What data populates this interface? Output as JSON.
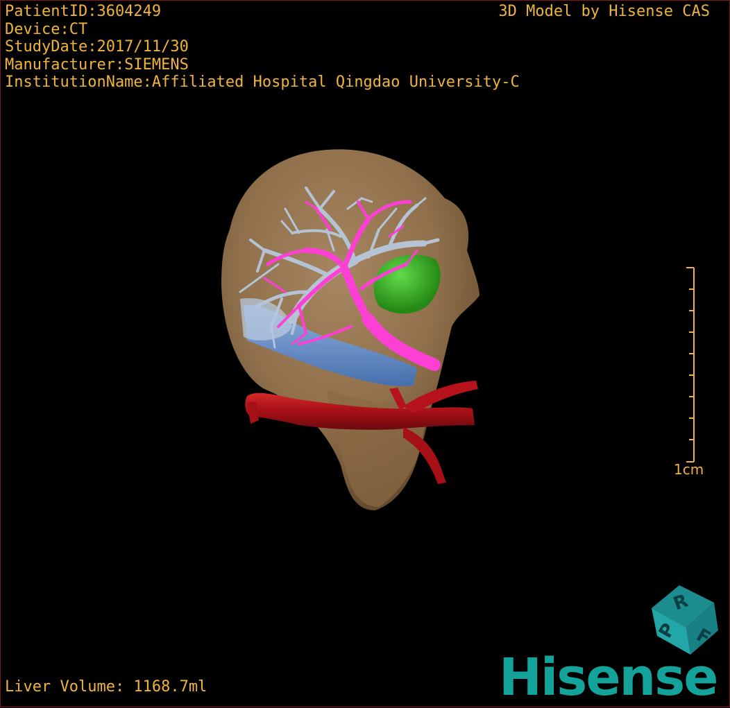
{
  "overlay": {
    "patient_id": "PatientID:3604249",
    "device": "Device:CT",
    "study_date": "StudyDate:2017/11/30",
    "manufacturer": "Manufacturer:SIEMENS",
    "institution": "InstitutionName:Affiliated Hospital Qingdao University-C",
    "credit": "3D Model by Hisense CAS",
    "liver_volume": "Liver Volume: 1168.7ml"
  },
  "scale_bar": {
    "label": "1cm"
  },
  "orientation_cube": {
    "faces": [
      "P",
      "R",
      "F"
    ]
  },
  "brand": {
    "name": "Hisense"
  },
  "colors": {
    "overlay_text": "#f0b43c",
    "liver": "#a6865a",
    "hepatic_vein": "#b7c8dc",
    "portal_vein": "#ff3fd6",
    "vena_cava": "#5a8fd6",
    "aorta": "#b5121b",
    "lesion": "#2fbf1e",
    "brand": "#13a39a"
  }
}
